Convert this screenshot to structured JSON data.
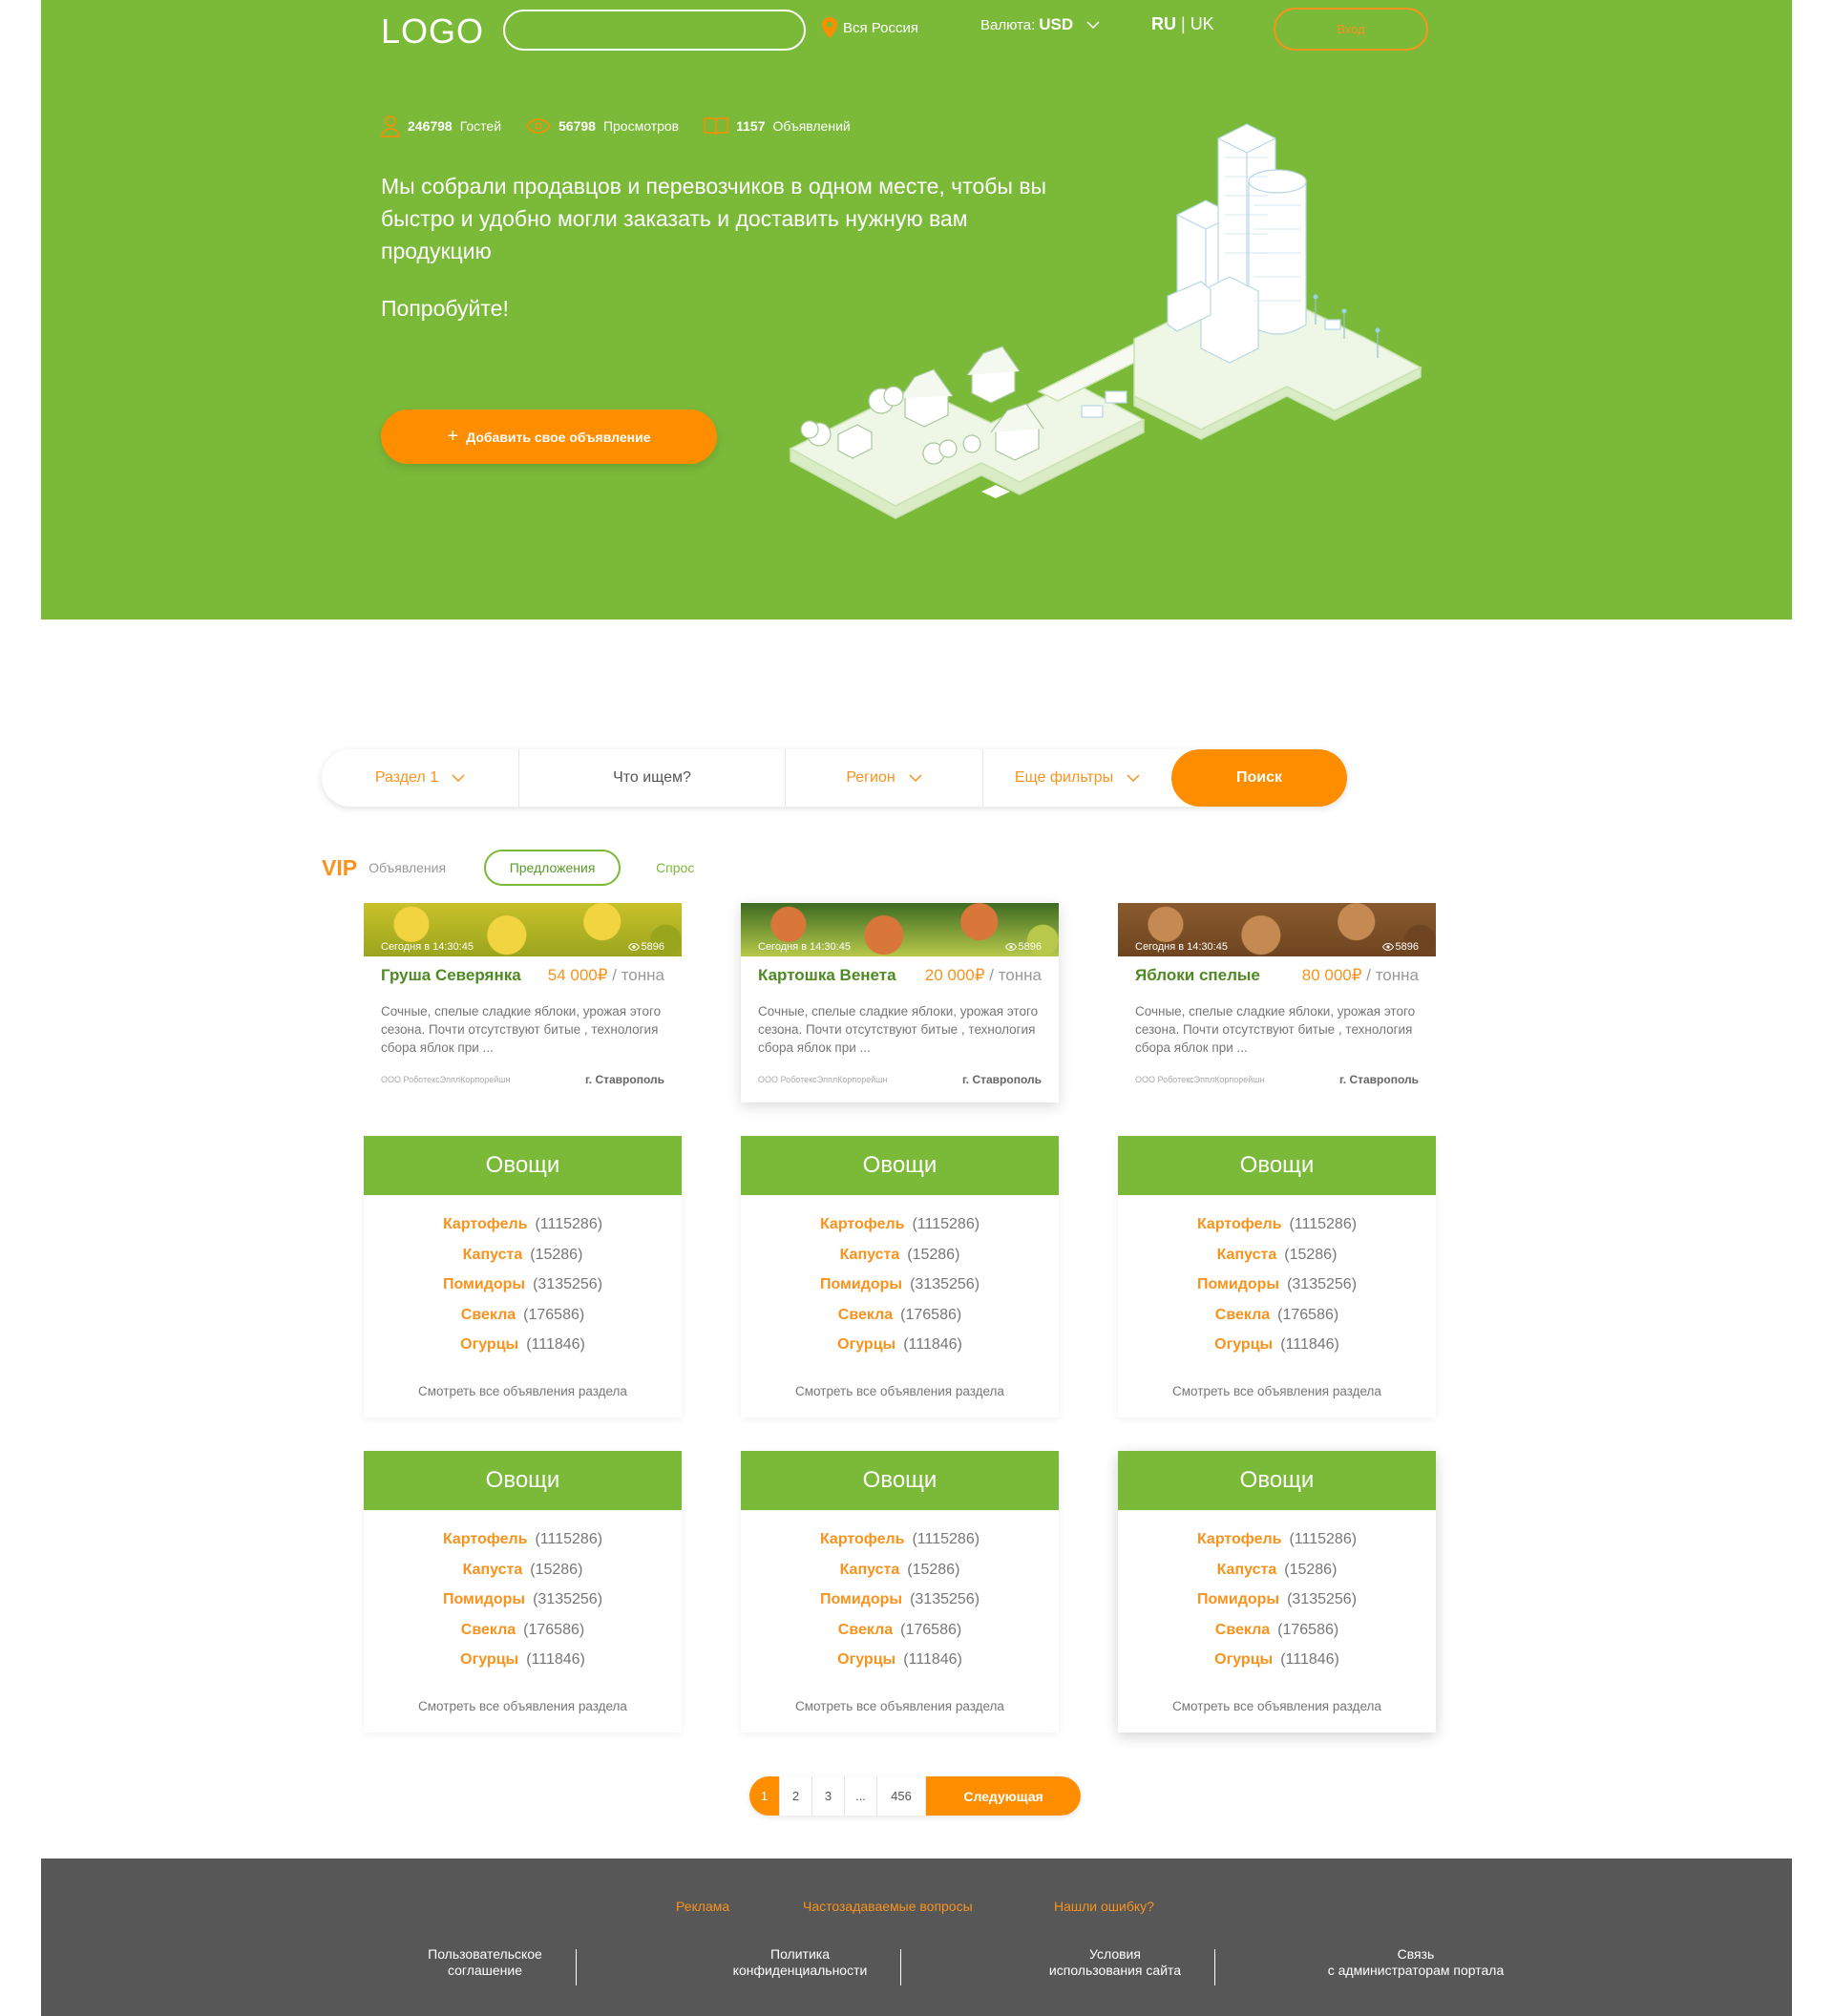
{
  "header": {
    "logo": "LOGO",
    "location": "Вся Россия",
    "currency_label": "Валюта:",
    "currency_value": "USD",
    "lang_ru": "RU",
    "lang_sep": " | ",
    "lang_uk": "UK",
    "login": "Вход"
  },
  "stats": [
    {
      "value": "246798",
      "label": "Гостей"
    },
    {
      "value": "56798",
      "label": "Просмотров"
    },
    {
      "value": "1157",
      "label": "Объявлений"
    }
  ],
  "hero": {
    "text": "Мы собрали продавцов и перевозчиков в одном месте, чтобы вы быстро и удобно могли заказать и доставить нужную вам продукцию",
    "try": "Попробуйте!",
    "add_button": "Добавить свое объявление"
  },
  "filter": {
    "section": "Раздел 1",
    "what": "Что ищем?",
    "region": "Регион",
    "more": "Еще фильтры",
    "search": "Поиск"
  },
  "tabs": {
    "vip": "VIP",
    "vip_sub": "Объявления",
    "offers": "Предложения",
    "demand": "Спрос"
  },
  "vip_cards": [
    {
      "date": "Сегодня в 14:30:45",
      "views": "5896",
      "title": "Груша Северянка",
      "price": "54 000₽",
      "unit": " / тонна",
      "desc": "Сочные, спелые сладкие яблоки, урожая этого сезона. Почти отсутствуют битые , технология сбора яблок при ...",
      "company": "ООО РоботексЭпплКорпорейшн",
      "city": "г. Ставрополь",
      "colors": [
        "#c9c12a",
        "#f2d440",
        "#9aa51e"
      ]
    },
    {
      "date": "Сегодня в 14:30:45",
      "views": "5896",
      "title": "Картошка Венета",
      "price": "20 000₽",
      "unit": " / тонна",
      "desc": "Сочные, спелые сладкие яблоки, урожая этого сезона. Почти отсутствуют битые , технология сбора яблок при ...",
      "company": "ООО РоботексЭпплКорпорейшн",
      "city": "г. Ставрополь",
      "colors": [
        "#3d6b22",
        "#d9763a",
        "#b8c84a"
      ]
    },
    {
      "date": "Сегодня в 14:30:45",
      "views": "5896",
      "title": "Яблоки спелые",
      "price": "80 000₽",
      "unit": " / тонна",
      "desc": "Сочные, спелые сладкие яблоки, урожая этого сезона. Почти отсутствуют битые , технология сбора яблок при ...",
      "company": "ООО РоботексЭпплКорпорейшн",
      "city": "г. Ставрополь",
      "colors": [
        "#8a5a2e",
        "#c48a52",
        "#6e4520"
      ]
    }
  ],
  "categories": [
    {
      "title": "Овощи",
      "items": [
        {
          "name": "Картофель",
          "count": "(1115286)"
        },
        {
          "name": "Капуста",
          "count": "(15286)"
        },
        {
          "name": "Помидоры",
          "count": "(3135256)"
        },
        {
          "name": "Свекла",
          "count": "(176586)"
        },
        {
          "name": "Огурцы",
          "count": "(111846)"
        }
      ],
      "more": "Смотреть все объявления раздела"
    },
    {
      "title": "Овощи",
      "items": [
        {
          "name": "Картофель",
          "count": "(1115286)"
        },
        {
          "name": "Капуста",
          "count": "(15286)"
        },
        {
          "name": "Помидоры",
          "count": "(3135256)"
        },
        {
          "name": "Свекла",
          "count": "(176586)"
        },
        {
          "name": "Огурцы",
          "count": "(111846)"
        }
      ],
      "more": "Смотреть все объявления раздела"
    },
    {
      "title": "Овощи",
      "items": [
        {
          "name": "Картофель",
          "count": "(1115286)"
        },
        {
          "name": "Капуста",
          "count": "(15286)"
        },
        {
          "name": "Помидоры",
          "count": "(3135256)"
        },
        {
          "name": "Свекла",
          "count": "(176586)"
        },
        {
          "name": "Огурцы",
          "count": "(111846)"
        }
      ],
      "more": "Смотреть все объявления раздела"
    },
    {
      "title": "Овощи",
      "items": [
        {
          "name": "Картофель",
          "count": "(1115286)"
        },
        {
          "name": "Капуста",
          "count": "(15286)"
        },
        {
          "name": "Помидоры",
          "count": "(3135256)"
        },
        {
          "name": "Свекла",
          "count": "(176586)"
        },
        {
          "name": "Огурцы",
          "count": "(111846)"
        }
      ],
      "more": "Смотреть все объявления раздела"
    },
    {
      "title": "Овощи",
      "items": [
        {
          "name": "Картофель",
          "count": "(1115286)"
        },
        {
          "name": "Капуста",
          "count": "(15286)"
        },
        {
          "name": "Помидоры",
          "count": "(3135256)"
        },
        {
          "name": "Свекла",
          "count": "(176586)"
        },
        {
          "name": "Огурцы",
          "count": "(111846)"
        }
      ],
      "more": "Смотреть все объявления раздела"
    },
    {
      "title": "Овощи",
      "items": [
        {
          "name": "Картофель",
          "count": "(1115286)"
        },
        {
          "name": "Капуста",
          "count": "(15286)"
        },
        {
          "name": "Помидоры",
          "count": "(3135256)"
        },
        {
          "name": "Свекла",
          "count": "(176586)"
        },
        {
          "name": "Огурцы",
          "count": "(111846)"
        }
      ],
      "more": "Смотреть все объявления раздела"
    }
  ],
  "pagination": {
    "pages": [
      "1",
      "2",
      "3",
      "...",
      "456"
    ],
    "active": "1",
    "next": "Следующая"
  },
  "footer": {
    "links": [
      "Реклама",
      "Частозадаваемые вопросы",
      "Нашли ошибку?"
    ],
    "columns": [
      [
        "Пользовательское",
        "соглашение"
      ],
      [
        "Политика",
        "конфиденциальности"
      ],
      [
        "Условия",
        "использования сайта"
      ],
      [
        "Связь",
        "с администраторам портала"
      ]
    ]
  },
  "colors": {
    "green": "#7aba38",
    "orange": "#ff8d00",
    "footer": "#575757"
  }
}
